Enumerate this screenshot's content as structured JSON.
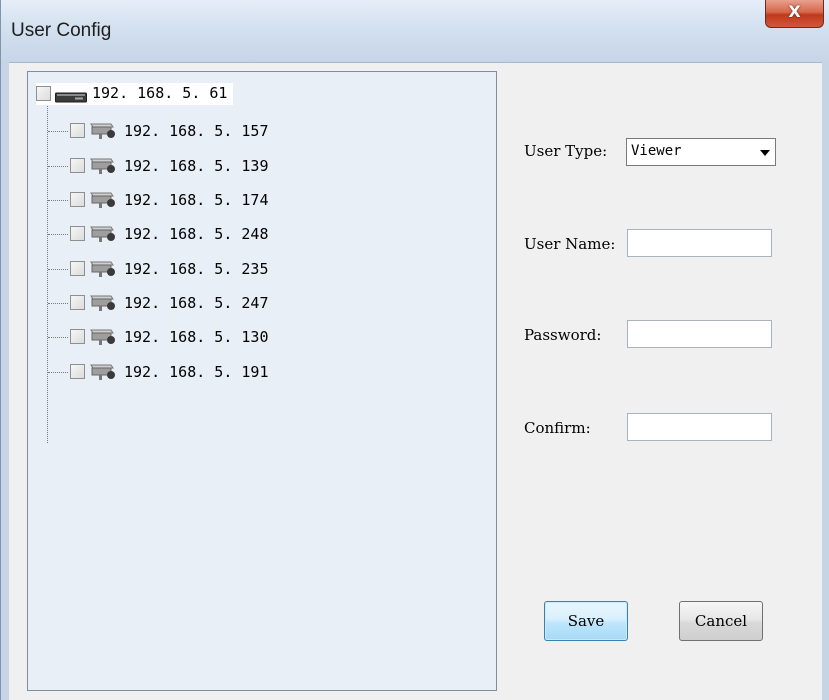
{
  "window": {
    "title": "User Config",
    "close_glyph": "X"
  },
  "tree": {
    "root": {
      "label": "192. 168. 5. 61",
      "icon": "dvr-icon",
      "checked": false
    },
    "items": [
      {
        "label": "192. 168. 5. 157",
        "icon": "camera-icon",
        "checked": false
      },
      {
        "label": "192. 168. 5. 139",
        "icon": "camera-icon",
        "checked": false
      },
      {
        "label": "192. 168. 5. 174",
        "icon": "camera-icon",
        "checked": false
      },
      {
        "label": "192. 168. 5. 248",
        "icon": "camera-icon",
        "checked": false
      },
      {
        "label": "192. 168. 5. 235",
        "icon": "camera-icon",
        "checked": false
      },
      {
        "label": "192. 168. 5. 247",
        "icon": "camera-icon",
        "checked": false
      },
      {
        "label": "192. 168. 5. 130",
        "icon": "camera-icon",
        "checked": false
      },
      {
        "label": "192. 168. 5. 191",
        "icon": "camera-icon",
        "checked": false
      }
    ]
  },
  "form": {
    "user_type_label": "User Type:",
    "user_type_value": "Viewer",
    "user_name_label": "User Name:",
    "user_name_value": "",
    "password_label": "Password:",
    "password_value": "",
    "confirm_label": "Confirm:",
    "confirm_value": ""
  },
  "buttons": {
    "save": "Save",
    "cancel": "Cancel"
  },
  "colors": {
    "titlebar": "#d3e0ef",
    "close_button": "#c0391c",
    "tree_background": "#e9eff6",
    "default_button": "#bee6fd"
  }
}
